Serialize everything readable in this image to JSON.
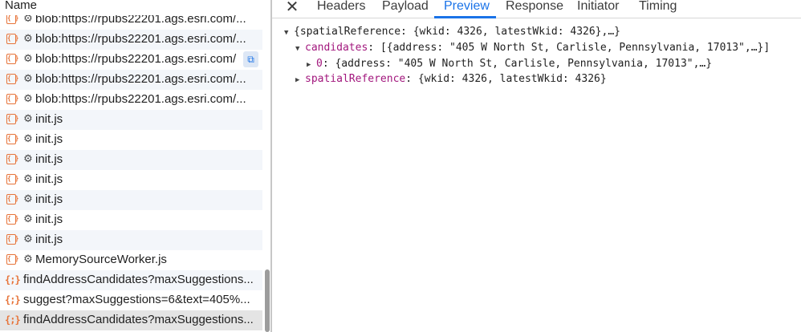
{
  "name_header": "Name",
  "requests": [
    {
      "type": "file",
      "gear": true,
      "label": "blob:https://rpubs22201.ags.esri.com/..."
    },
    {
      "type": "file",
      "gear": true,
      "label": "blob:https://rpubs22201.ags.esri.com/..."
    },
    {
      "type": "file",
      "gear": true,
      "label": "blob:https://rpubs22201.ags.esri.com/"
    },
    {
      "type": "file",
      "gear": true,
      "label": "blob:https://rpubs22201.ags.esri.com/..."
    },
    {
      "type": "file",
      "gear": true,
      "label": "blob:https://rpubs22201.ags.esri.com/..."
    },
    {
      "type": "file",
      "gear": true,
      "label": "init.js"
    },
    {
      "type": "file",
      "gear": true,
      "label": "init.js"
    },
    {
      "type": "file",
      "gear": true,
      "label": "init.js"
    },
    {
      "type": "file",
      "gear": true,
      "label": "init.js"
    },
    {
      "type": "file",
      "gear": true,
      "label": "init.js"
    },
    {
      "type": "file",
      "gear": true,
      "label": "init.js"
    },
    {
      "type": "file",
      "gear": true,
      "label": "init.js"
    },
    {
      "type": "file",
      "gear": true,
      "label": "MemorySourceWorker.js"
    },
    {
      "type": "json",
      "gear": false,
      "label": "findAddressCandidates?maxSuggestions..."
    },
    {
      "type": "json",
      "gear": false,
      "label": "suggest?maxSuggestions=6&text=405%..."
    },
    {
      "type": "json",
      "gear": false,
      "label": "findAddressCandidates?maxSuggestions..."
    }
  ],
  "icons": {
    "file": "{ }",
    "json": "{;}",
    "gear": "⚙",
    "close": "✕",
    "copy": "⧉"
  },
  "tabs": [
    {
      "label": "Headers",
      "active": false
    },
    {
      "label": "Payload",
      "active": false
    },
    {
      "label": "Preview",
      "active": true
    },
    {
      "label": "Response",
      "active": false
    },
    {
      "label": "Initiator",
      "active": false
    },
    {
      "label": "Timing",
      "active": false
    }
  ],
  "preview": {
    "root": "{spatialReference: {wkid: 4326, latestWkid: 4326},…}",
    "candidates_key": "candidates",
    "candidates_value": "[{address: \"405 W North St, Carlisle, Pennsylvania, 17013\",…}]",
    "item0_key": "0",
    "item0_value": "{address: \"405 W North St, Carlisle, Pennsylvania, 17013\",…}",
    "sr_key": "spatialReference",
    "sr_value": "{wkid: 4326, latestWkid: 4326}"
  },
  "colors": {
    "accent": "#1a73e8",
    "file_icon": "#e7743a",
    "json_key": "#a2177d"
  }
}
